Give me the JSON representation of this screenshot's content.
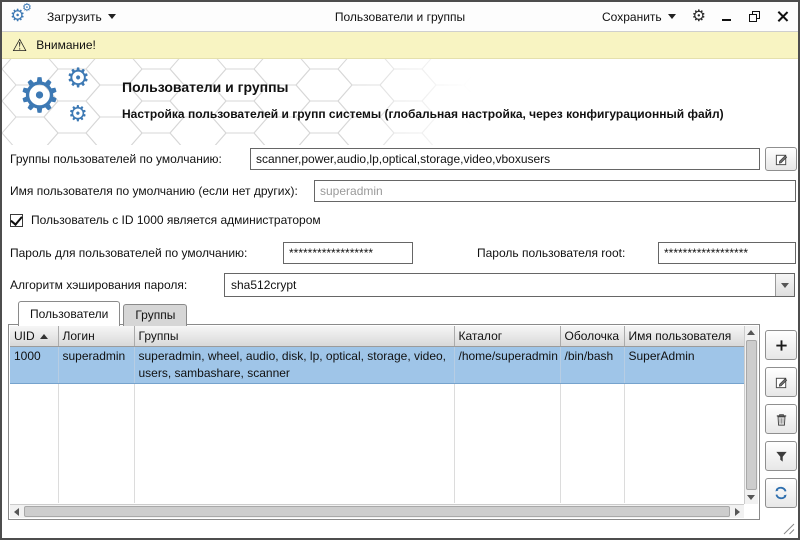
{
  "window": {
    "load_label": "Загрузить",
    "title": "Пользователи и группы",
    "save_label": "Сохранить"
  },
  "warning": {
    "text": "Внимание!"
  },
  "header": {
    "title": "Пользователи и группы",
    "subtitle": "Настройка пользователей и групп системы (глобальная настройка, через конфигурационный файл)"
  },
  "form": {
    "default_groups_label": "Группы пользователей по умолчанию:",
    "default_groups_value": "scanner,power,audio,lp,optical,storage,video,vboxusers",
    "default_user_label": "Имя пользователя по умолчанию (если нет других):",
    "default_user_placeholder": "superadmin",
    "admin_checkbox_label": "Пользователь с ID 1000 является администратором",
    "admin_checkbox_checked": true,
    "default_password_label": "Пароль для пользователей по умолчанию:",
    "default_password_value": "******************",
    "root_password_label": "Пароль пользователя root:",
    "root_password_value": "******************",
    "hash_label": "Алгоритм хэширования пароля:",
    "hash_value": "sha512crypt"
  },
  "tabs": [
    {
      "label": "Пользователи",
      "active": true
    },
    {
      "label": "Группы",
      "active": false
    }
  ],
  "table": {
    "columns": [
      "UID",
      "Логин",
      "Группы",
      "Каталог",
      "Оболочка",
      "Имя пользователя"
    ],
    "sort": {
      "column": "UID",
      "direction": "asc"
    },
    "rows": [
      {
        "uid": "1000",
        "login": "superadmin",
        "groups": "superadmin, wheel, audio, disk, lp, optical, storage, video, users, sambashare, scanner",
        "home": "/home/superadmin",
        "shell": "/bin/bash",
        "name": "SuperAdmin"
      }
    ]
  },
  "colors": {
    "accent": "#3D79B4",
    "selection": "#9FC5E8",
    "warning_bg": "#F8F4C2"
  },
  "icons": {
    "app": "gears",
    "warning": "warning-triangle",
    "settings": "gear",
    "field_edit": "pencil-pad",
    "add": "plus",
    "edit": "pencil-pad",
    "delete": "trash",
    "filter": "funnel",
    "refresh": "sync-arrows"
  }
}
